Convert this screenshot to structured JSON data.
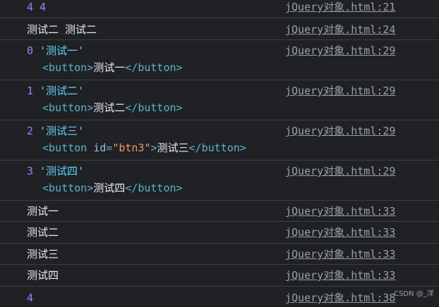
{
  "rows": [
    {
      "a": "4",
      "b": "4",
      "source": "jQuery对象.html:21"
    },
    {
      "a": "测试二",
      "b": "测试二",
      "source": "jQuery对象.html:24"
    },
    {
      "index": "0",
      "string": "'测试一'",
      "open_tag": "<button>",
      "inner": "测试一",
      "close_tag": "</button>",
      "source": "jQuery对象.html:29"
    },
    {
      "index": "1",
      "string": "'测试二'",
      "open_tag": "<button>",
      "inner": "测试二",
      "close_tag": "</button>",
      "source": "jQuery对象.html:29"
    },
    {
      "index": "2",
      "string": "'测试三'",
      "tag_name": "<button",
      "attr_name": "id",
      "equals": "=",
      "attr_value": "\"btn3\"",
      "tag_end": ">",
      "inner": "测试三",
      "close_tag": "</button>",
      "source": "jQuery对象.html:29"
    },
    {
      "index": "3",
      "string": "'测试四'",
      "open_tag": "<button>",
      "inner": "测试四",
      "close_tag": "</button>",
      "source": "jQuery对象.html:29"
    },
    {
      "text": "测试一",
      "source": "jQuery对象.html:33"
    },
    {
      "text": "测试二",
      "source": "jQuery对象.html:33"
    },
    {
      "text": "测试三",
      "source": "jQuery对象.html:33"
    },
    {
      "text": "测试四",
      "source": "jQuery对象.html:33"
    },
    {
      "value": "4",
      "source": "jQuery对象.html:38"
    }
  ],
  "watermark": "CSDN @_洋",
  "colors": {
    "background": "#202124",
    "number": "#9980ff",
    "string": "#5cd5fb",
    "tag": "#5db0d7",
    "attribute_name": "#9bbbdc",
    "attribute_value": "#f29766",
    "text": "#e8eaed",
    "source_link": "#9aa0a6"
  }
}
